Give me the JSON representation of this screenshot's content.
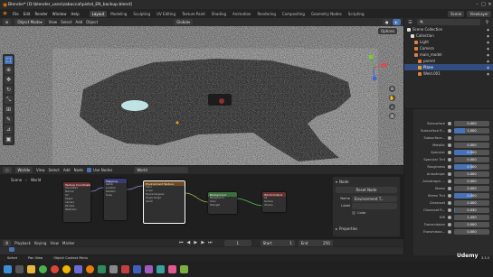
{
  "window": {
    "title": "Blender* [D:\\blender_uses\\zabaccal\\pistol_EN_backup.blend]"
  },
  "menu": [
    "File",
    "Edit",
    "Render",
    "Window",
    "Help"
  ],
  "workspaces": [
    {
      "label": "Layout",
      "active": true
    },
    {
      "label": "Modeling",
      "active": false
    },
    {
      "label": "Sculpting",
      "active": false
    },
    {
      "label": "UV Editing",
      "active": false
    },
    {
      "label": "Texture Paint",
      "active": false
    },
    {
      "label": "Shading",
      "active": false
    },
    {
      "label": "Animation",
      "active": false
    },
    {
      "label": "Rendering",
      "active": false
    },
    {
      "label": "Compositing",
      "active": false
    },
    {
      "label": "Geometry Nodes",
      "active": false
    },
    {
      "label": "Scripting",
      "active": false
    }
  ],
  "scene_field": "Scene",
  "viewlayer_field": "ViewLayer",
  "viewport": {
    "mode": "Object Mode",
    "menus": [
      "View",
      "Select",
      "Add",
      "Object"
    ],
    "transform": "Global",
    "options_label": "Options"
  },
  "outliner": {
    "items": [
      {
        "label": "Scene Collection",
        "selected": false
      },
      {
        "label": "Collection",
        "selected": false
      },
      {
        "label": "Light",
        "selected": false
      },
      {
        "label": "Camera",
        "selected": false
      },
      {
        "label": "main_model",
        "selected": false
      },
      {
        "label": "parent",
        "selected": false
      },
      {
        "label": "Plane",
        "selected": true
      },
      {
        "label": "Weld.001",
        "selected": false
      }
    ]
  },
  "properties": [
    {
      "label": "Subsurface",
      "value": "0.000",
      "fill": 0
    },
    {
      "label": "Subsurface R...",
      "value": "1.000",
      "fill": 0.3
    },
    {
      "label": "Subsurface...",
      "value": "",
      "fill": 0
    },
    {
      "label": "Metallic",
      "value": "0.000",
      "fill": 0
    },
    {
      "label": "Specular",
      "value": "0.500",
      "fill": 0.5
    },
    {
      "label": "Specular Tint",
      "value": "0.000",
      "fill": 0
    },
    {
      "label": "Roughness",
      "value": "0.500",
      "fill": 0.5
    },
    {
      "label": "Anisotropic",
      "value": "0.000",
      "fill": 0
    },
    {
      "label": "Anisotropic ...",
      "value": "0.000",
      "fill": 0
    },
    {
      "label": "Sheen",
      "value": "0.000",
      "fill": 0
    },
    {
      "label": "Sheen Tint",
      "value": "0.500",
      "fill": 0.5
    },
    {
      "label": "Clearcoat",
      "value": "0.000",
      "fill": 0
    },
    {
      "label": "Clearcoat R...",
      "value": "0.030",
      "fill": 0.03
    },
    {
      "label": "IOR",
      "value": "1.450",
      "fill": 0
    },
    {
      "label": "Transmission",
      "value": "0.000",
      "fill": 0
    },
    {
      "label": "Transmissio...",
      "value": "0.000",
      "fill": 0
    }
  ],
  "node_editor": {
    "type_label": "World",
    "menus": [
      "View",
      "Select",
      "Add",
      "Node"
    ],
    "use_nodes_label": "Use Nodes",
    "world_field": "World",
    "breadcrumb": [
      "Scene",
      "World"
    ],
    "panel": {
      "title": "Node",
      "reset_label": "Reset Node",
      "name_label": "Name",
      "name_value": "Environment T...",
      "label_label": "Label",
      "color_label": "Color",
      "properties_label": "Properties"
    },
    "nodes": [
      "Texture Coordinate",
      "Mapping",
      "Environment Texture",
      "Background",
      "World Output"
    ]
  },
  "timeline": {
    "menus": [
      "Playback",
      "Keying",
      "View",
      "Marker"
    ],
    "current_frame": "1",
    "start_label": "Start",
    "start_value": "1",
    "end_label": "End",
    "end_value": "250"
  },
  "statusbar": {
    "select": "Select",
    "pan_view": "Pan View",
    "context_menu": "Object Context Menu",
    "version": "3.3.0"
  },
  "watermark": "Udemy",
  "colors": {
    "accent": "#4772b3",
    "selection": "#334d80",
    "node_header_tex": "#6e4a24",
    "node_header_vec": "#3a3a75",
    "node_header_shader": "#3d6e3d",
    "node_header_out": "#6b3030"
  }
}
